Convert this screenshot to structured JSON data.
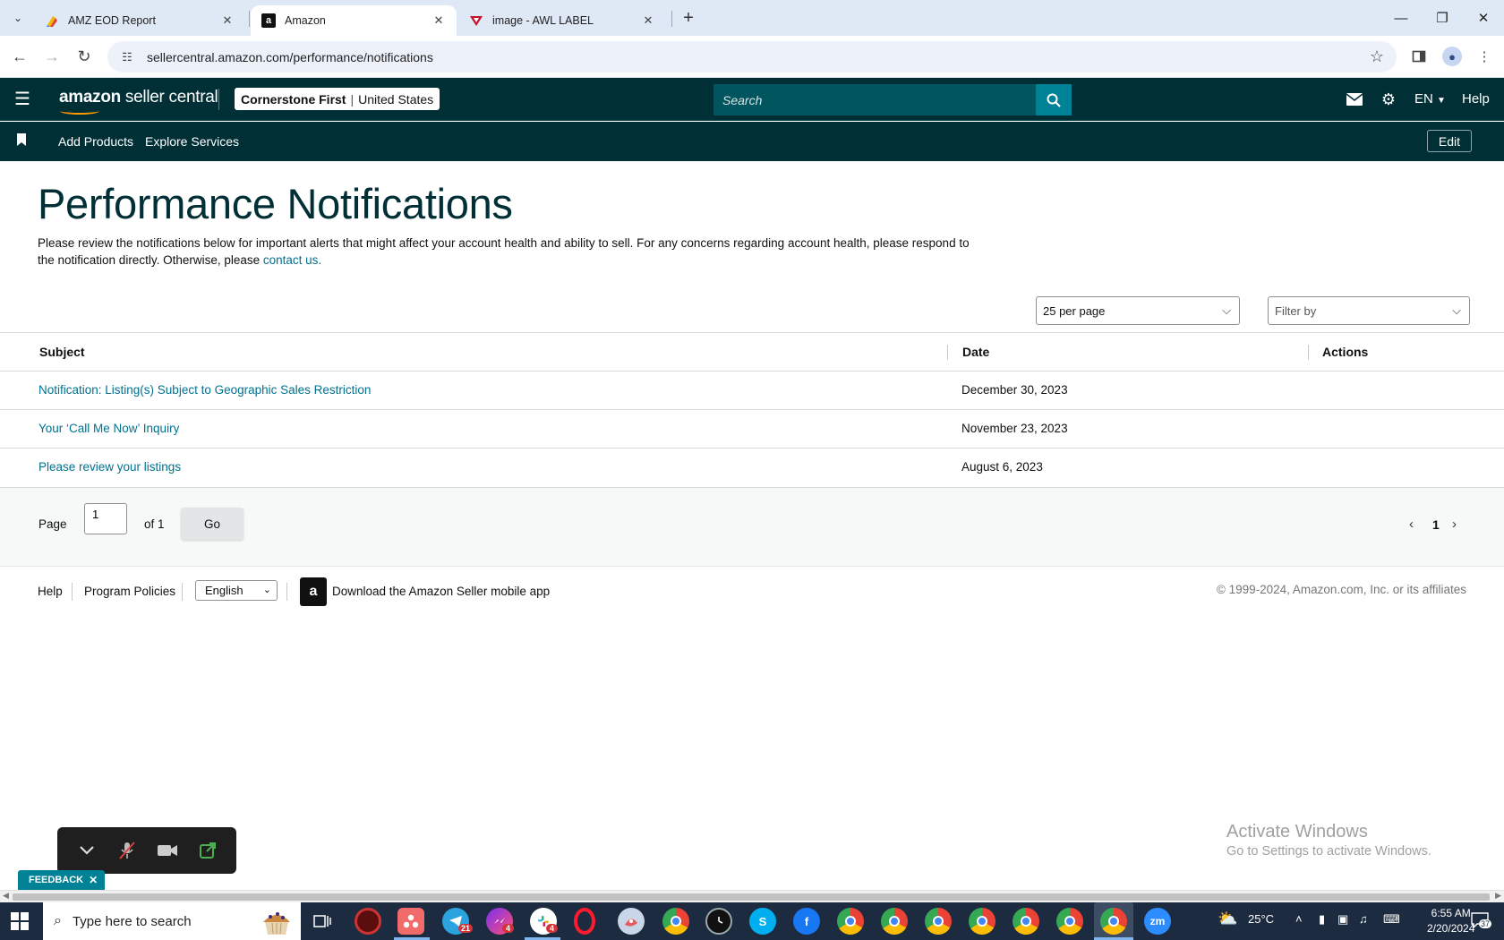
{
  "browser": {
    "tabs": [
      {
        "title": "AMZ EOD Report",
        "icon": "google-sheets-icon"
      },
      {
        "title": "Amazon",
        "icon": "amazon-icon"
      },
      {
        "title": "image - AWL LABEL",
        "icon": "awl-icon"
      }
    ],
    "url": "sellercentral.amazon.com/performance/notifications"
  },
  "header": {
    "logo_amazon": "amazon",
    "logo_suffix": " seller central",
    "account_name": "Cornerstone First",
    "account_separator": "|",
    "marketplace": "United States",
    "search_placeholder": "Search",
    "language": "EN",
    "help": "Help"
  },
  "subnav": {
    "links": [
      "Add Products",
      "Explore Services"
    ],
    "edit_label": "Edit"
  },
  "page": {
    "title": "Performance Notifications",
    "intro_text": "Please review the notifications below for important alerts that might affect your account health and ability to sell. For any concerns regarding account health, please respond to the notification directly. Otherwise, please ",
    "intro_link": "contact us."
  },
  "controls": {
    "per_page": "25 per page",
    "filter_placeholder": "Filter by"
  },
  "table": {
    "columns": [
      "Subject",
      "Date",
      "Actions"
    ],
    "rows": [
      {
        "subject": "Notification: Listing(s) Subject to Geographic Sales Restriction",
        "date": "December 30, 2023"
      },
      {
        "subject": "Your ‘Call Me Now’ Inquiry",
        "date": "November 23, 2023"
      },
      {
        "subject": "Please review your listings",
        "date": "August 6, 2023"
      }
    ]
  },
  "pagination": {
    "page_label": "Page",
    "page_value": "1",
    "of_label": "of 1",
    "go_label": "Go",
    "current_page": "1"
  },
  "footer": {
    "help": "Help",
    "program_policies": "Program Policies",
    "language": "English",
    "mobile_app": "Download the Amazon Seller mobile app",
    "copyright": "© 1999-2024, Amazon.com, Inc. or its affiliates"
  },
  "overlay": {
    "activate_title": "Activate Windows",
    "activate_sub": "Go to Settings to activate Windows.",
    "feedback": "FEEDBACK"
  },
  "taskbar": {
    "search_placeholder": "Type here to search",
    "telegram_badge": "21",
    "messenger_badge": "4",
    "slack_badge": "4",
    "temperature": "25°C",
    "time": "6:55 AM",
    "date": "2/20/2024",
    "notifications": "37"
  },
  "colors": {
    "header_bg": "#002f36",
    "search_bg": "#00555f",
    "search_btn": "#008296",
    "link": "#00718f",
    "title": "#002f36"
  }
}
